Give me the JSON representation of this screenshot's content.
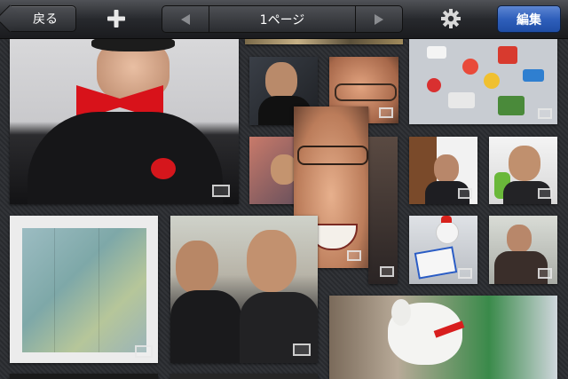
{
  "toolbar": {
    "back_label": "戻る",
    "add_icon": "plus-icon",
    "pager": {
      "label": "1ページ",
      "prev_icon": "triangle-left-icon",
      "next_icon": "triangle-right-icon"
    },
    "settings_icon": "gear-icon",
    "edit_label": "編集"
  },
  "colors": {
    "toolbar_bg": "#27292d",
    "edit_button": "#2f5fbb",
    "background": "#2b2d31"
  },
  "photos": [
    {
      "name": "photo-man-bowtie",
      "badge": "frame-icon"
    },
    {
      "name": "photo-strip-top",
      "badge": "frame-icon"
    },
    {
      "name": "photo-man-glasses-camera",
      "badge": "frame-icon"
    },
    {
      "name": "photo-closeup-eyes",
      "badge": "frame-icon"
    },
    {
      "name": "photo-stickers-laptop",
      "badge": "frame-icon"
    },
    {
      "name": "photo-man-smiling-small",
      "badge": "frame-icon"
    },
    {
      "name": "photo-closeup-smile",
      "badge": "frame-icon"
    },
    {
      "name": "photo-man-dark",
      "badge": "frame-icon"
    },
    {
      "name": "photo-man-headphones-1",
      "badge": "frame-icon"
    },
    {
      "name": "photo-man-headphones-2",
      "badge": "frame-icon"
    },
    {
      "name": "photo-map",
      "badge": "frame-icon"
    },
    {
      "name": "photo-two-men",
      "badge": "frame-icon"
    },
    {
      "name": "photo-mascot-sign",
      "badge": "frame-icon"
    },
    {
      "name": "photo-man-laptop",
      "badge": "frame-icon"
    },
    {
      "name": "photo-dog-mascot",
      "badge": "frame-icon"
    }
  ]
}
